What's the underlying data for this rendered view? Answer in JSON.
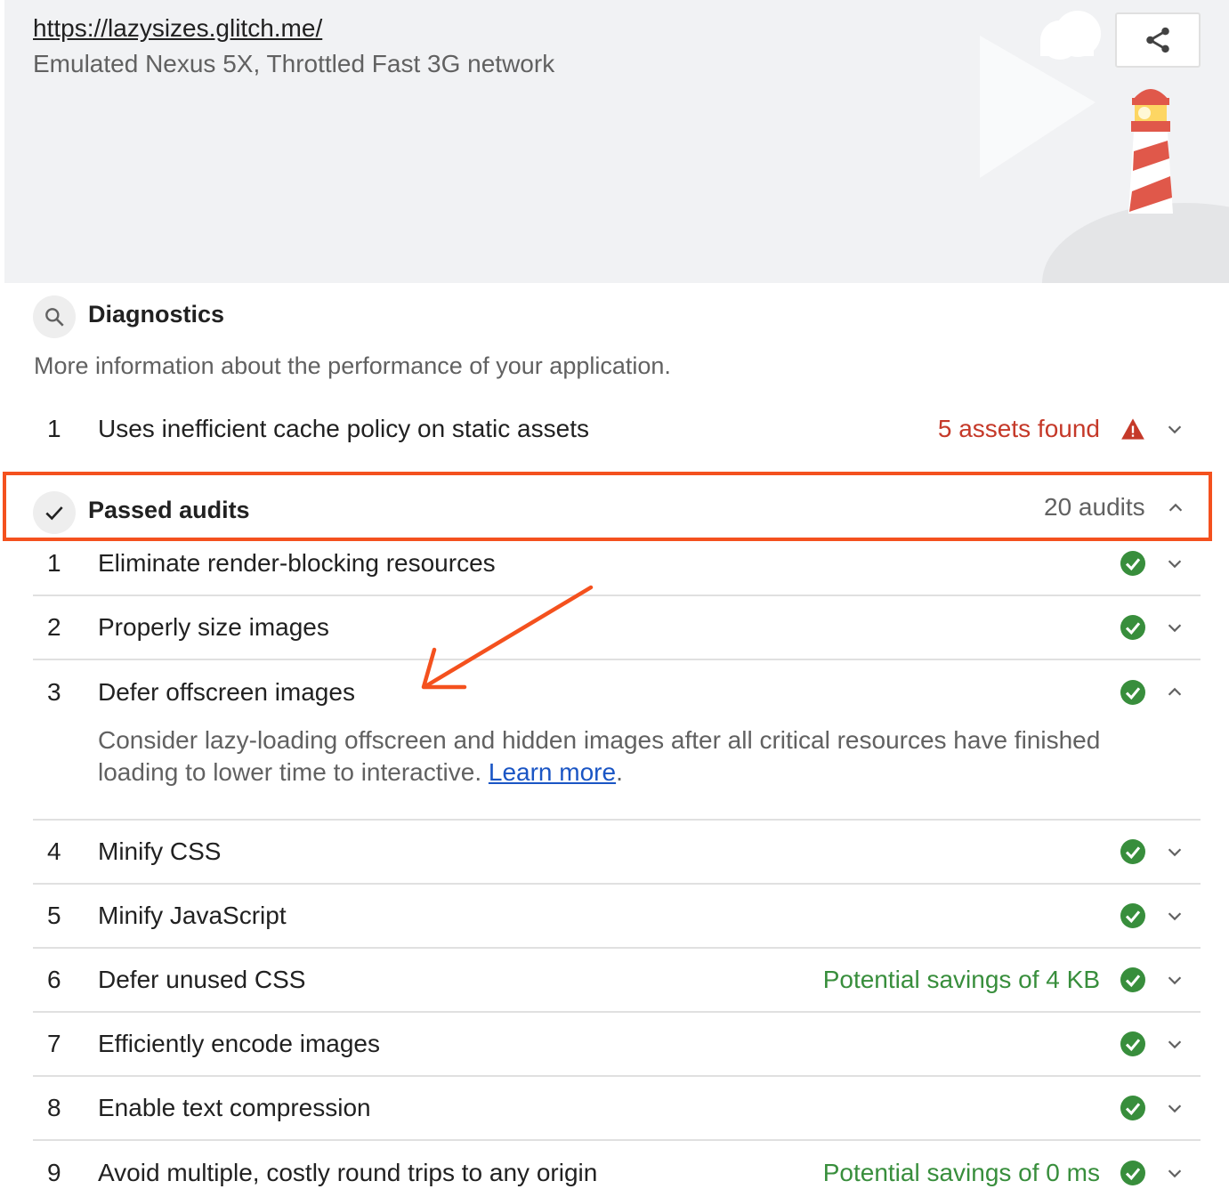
{
  "header": {
    "url": "https://lazysizes.glitch.me/",
    "environment": "Emulated Nexus 5X, Throttled Fast 3G network",
    "share_icon": "share-icon"
  },
  "diagnostics": {
    "title": "Diagnostics",
    "description": "More information about the performance of your application.",
    "items": [
      {
        "num": "1",
        "title": "Uses inefficient cache policy on static assets",
        "summary": "5 assets found",
        "status": "warning"
      }
    ]
  },
  "passed": {
    "title": "Passed audits",
    "count": "20 audits",
    "items": [
      {
        "num": "1",
        "title": "Eliminate render-blocking resources",
        "summary": ""
      },
      {
        "num": "2",
        "title": "Properly size images",
        "summary": ""
      },
      {
        "num": "3",
        "title": "Defer offscreen images",
        "summary": "",
        "expanded": true,
        "description": "Consider lazy-loading offscreen and hidden images after all critical resources have finished loading to lower time to interactive.",
        "link": "Learn more",
        "period": "."
      },
      {
        "num": "4",
        "title": "Minify CSS",
        "summary": ""
      },
      {
        "num": "5",
        "title": "Minify JavaScript",
        "summary": ""
      },
      {
        "num": "6",
        "title": "Defer unused CSS",
        "summary": "Potential savings of 4 KB"
      },
      {
        "num": "7",
        "title": "Efficiently encode images",
        "summary": ""
      },
      {
        "num": "8",
        "title": "Enable text compression",
        "summary": ""
      },
      {
        "num": "9",
        "title": "Avoid multiple, costly round trips to any origin",
        "summary": "Potential savings of 0 ms"
      }
    ]
  },
  "colors": {
    "fail": "#c53929",
    "pass": "#388e3c",
    "highlight": "#f4511e",
    "link": "#1a55c4"
  }
}
